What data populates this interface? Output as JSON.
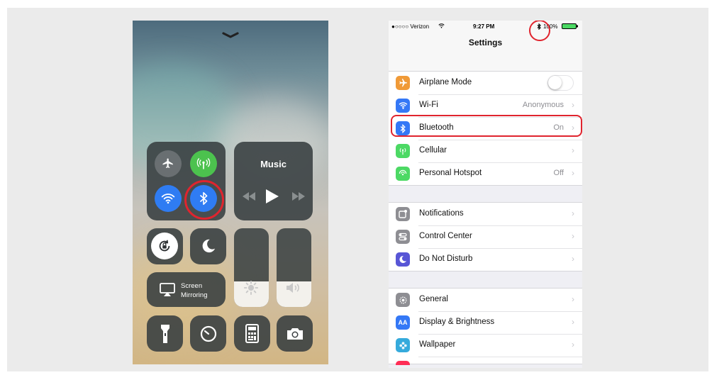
{
  "control_center": {
    "music_label": "Music",
    "screen_mirroring_label": "Screen\nMirroring",
    "brightness_level": 0.32,
    "volume_level": 0.32,
    "highlighted": "bluetooth"
  },
  "settings": {
    "status_bar": {
      "carrier": "●○○○○ Verizon",
      "time": "9:27 PM",
      "battery": "100%"
    },
    "title": "Settings",
    "groups": [
      [
        {
          "label": "Airplane Mode",
          "icon": "airplane-icon",
          "color": "#f09a37",
          "toggle": false
        },
        {
          "label": "Wi-Fi",
          "icon": "wifi-icon",
          "color": "#3478f6",
          "value": "Anonymous"
        },
        {
          "label": "Bluetooth",
          "icon": "bluetooth-icon",
          "color": "#3478f6",
          "value": "On"
        },
        {
          "label": "Cellular",
          "icon": "cellular-icon",
          "color": "#4cd964"
        },
        {
          "label": "Personal Hotspot",
          "icon": "hotspot-icon",
          "color": "#4cd964",
          "value": "Off"
        }
      ],
      [
        {
          "label": "Notifications",
          "icon": "notifications-icon",
          "color": "#8e8e93"
        },
        {
          "label": "Control Center",
          "icon": "control-center-icon",
          "color": "#8e8e93"
        },
        {
          "label": "Do Not Disturb",
          "icon": "moon-icon",
          "color": "#5856d6"
        }
      ],
      [
        {
          "label": "General",
          "icon": "gear-icon",
          "color": "#8e8e93"
        },
        {
          "label": "Display & Brightness",
          "icon": "display-icon",
          "color": "#3478f6"
        },
        {
          "label": "Wallpaper",
          "icon": "wallpaper-icon",
          "color": "#35aadc"
        }
      ]
    ]
  }
}
